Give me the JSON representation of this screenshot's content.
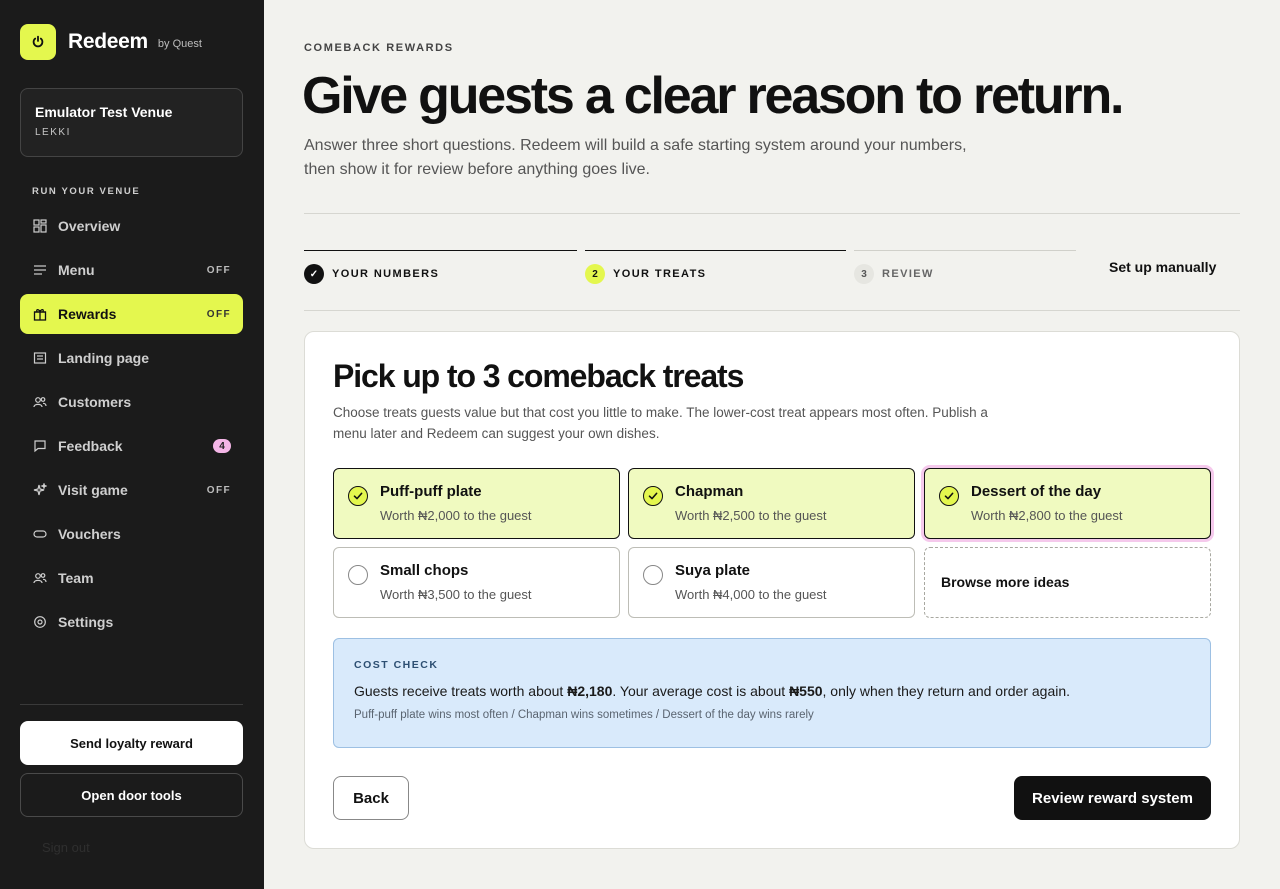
{
  "brand": {
    "name": "Redeem",
    "by": "by Quest",
    "logo_icon": "power-icon"
  },
  "venue": {
    "name": "Emulator Test Venue",
    "location": "LEKKI"
  },
  "sidebar": {
    "section_label": "RUN YOUR VENUE",
    "items": [
      {
        "label": "Overview",
        "icon": "grid-icon",
        "tag": ""
      },
      {
        "label": "Menu",
        "icon": "list-icon",
        "tag": "OFF"
      },
      {
        "label": "Rewards",
        "icon": "gift-icon",
        "tag": "OFF",
        "active": true
      },
      {
        "label": "Landing page",
        "icon": "page-icon",
        "tag": ""
      },
      {
        "label": "Customers",
        "icon": "users-icon",
        "tag": ""
      },
      {
        "label": "Feedback",
        "icon": "chat-icon",
        "badge": "4"
      },
      {
        "label": "Visit game",
        "icon": "sparkle-icon",
        "tag": "OFF"
      },
      {
        "label": "Vouchers",
        "icon": "ticket-icon",
        "tag": ""
      },
      {
        "label": "Team",
        "icon": "team-icon",
        "tag": ""
      },
      {
        "label": "Settings",
        "icon": "gear-icon",
        "tag": ""
      }
    ],
    "send_loyalty_label": "Send loyalty reward",
    "door_tools_label": "Open door tools",
    "sign_out_label": "Sign out"
  },
  "header": {
    "eyebrow": "COMEBACK REWARDS",
    "title": "Give guests a clear reason to return.",
    "subtitle": "Answer three short questions. Redeem will build a safe starting system around your numbers, then show it for review before anything goes live."
  },
  "steps": [
    {
      "num": "✓",
      "label": "YOUR NUMBERS",
      "state": "done"
    },
    {
      "num": "2",
      "label": "YOUR TREATS",
      "state": "current"
    },
    {
      "num": "3",
      "label": "REVIEW",
      "state": "upcoming"
    }
  ],
  "setup_manual_label": "Set up manually",
  "card": {
    "title": "Pick up to 3 comeback treats",
    "description": "Choose treats guests value but that cost you little to make. The lower-cost treat appears most often. Publish a menu later and Redeem can suggest your own dishes.",
    "treats": [
      {
        "name": "Puff-puff plate",
        "worth": "Worth ₦2,000 to the guest",
        "selected": true
      },
      {
        "name": "Chapman",
        "worth": "Worth ₦2,500 to the guest",
        "selected": true
      },
      {
        "name": "Dessert of the day",
        "worth": "Worth ₦2,800 to the guest",
        "selected": true
      },
      {
        "name": "Small chops",
        "worth": "Worth ₦3,500 to the guest",
        "selected": false
      },
      {
        "name": "Suya plate",
        "worth": "Worth ₦4,000 to the guest",
        "selected": false
      }
    ],
    "browse_label": "Browse more ideas",
    "cost_check": {
      "label": "COST CHECK",
      "text_before_worth": "Guests receive treats worth about ",
      "worth_value": "₦2,180",
      "text_mid": ". Your average cost is about ",
      "cost_value": "₦550",
      "text_after": ", only when they return and order again.",
      "footnote": "Puff-puff plate wins most often / Chapman wins sometimes / Dessert of the day wins rarely"
    },
    "back_label": "Back",
    "review_label": "Review reward system"
  },
  "colors": {
    "accent": "#e4f74e",
    "sidebar_bg": "#1b1b1b",
    "page_bg": "#f2f2ee",
    "info_bg": "#d9eafb",
    "badge_pink": "#f4b6e7"
  }
}
